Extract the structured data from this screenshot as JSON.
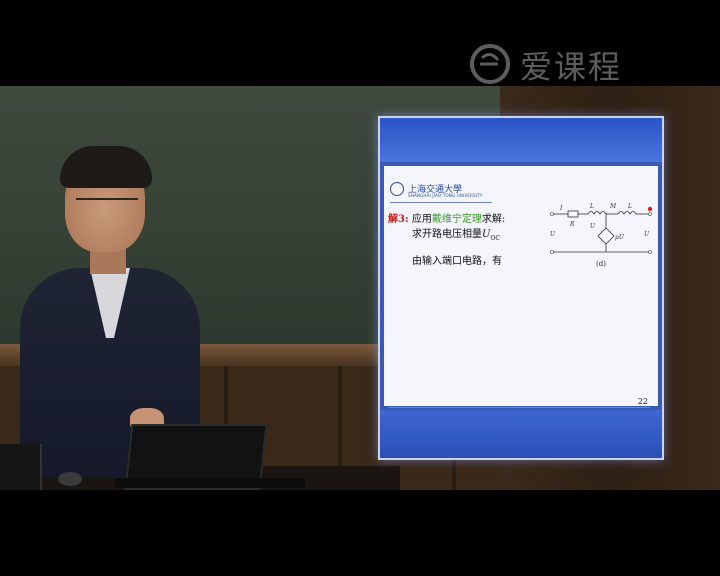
{
  "watermark": {
    "brand": "爱课程",
    "icon": "aikecheng-e-logo-icon"
  },
  "slide": {
    "university_logo_text": "上海交通大學",
    "university_logo_sub": "SHANGHAI JIAO TONG UNIVERSITY",
    "step_label": "解3:",
    "step_pre": "应用",
    "step_keyword": "戴维宁定理",
    "step_post": "求解:",
    "sub_text": "求开路电压相量",
    "sub_symbol": "U",
    "sub_symbol_sub": "OC",
    "input_text": "由输入端口电路，有",
    "figure_label": "(d)",
    "page_number": "22",
    "circuit_labels": {
      "source": "U",
      "current": "I",
      "r": "R",
      "l1": "L",
      "m": "M",
      "l2": "L",
      "u11": "U",
      "ctrl": "μU",
      "uoc": "U"
    }
  },
  "colors": {
    "step_label": "#d01e1e",
    "keyword": "#3a9a2a",
    "frame_blue": "#3a5bb5"
  }
}
